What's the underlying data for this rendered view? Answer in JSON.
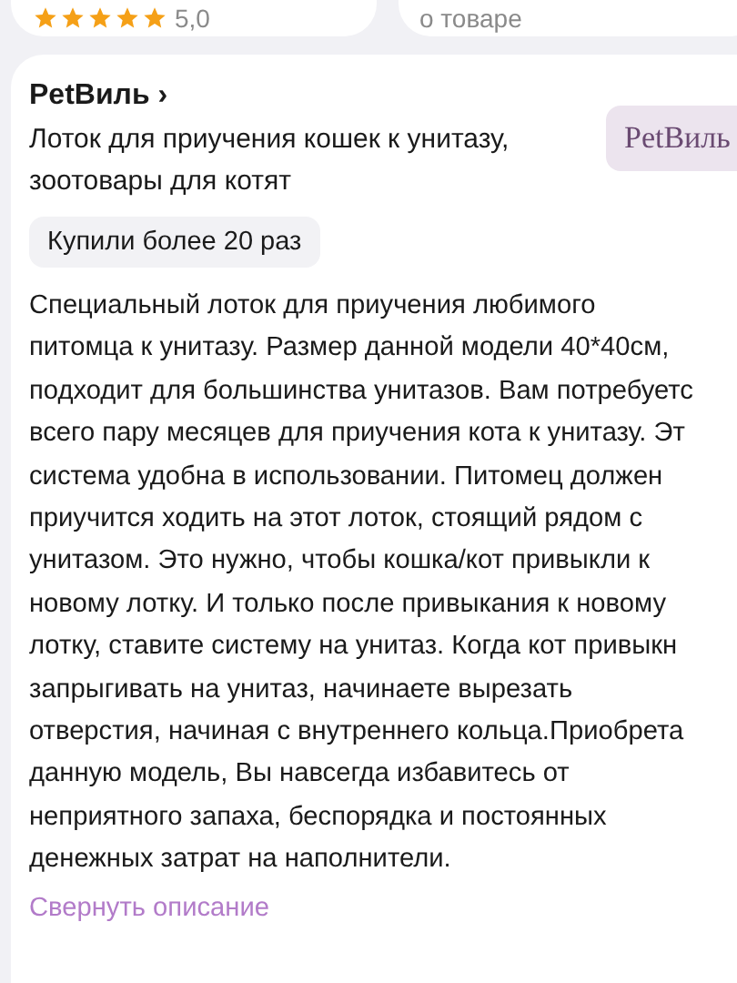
{
  "top_cards": [
    {
      "kind": "rating",
      "stars": 5,
      "rating": "5,0"
    },
    {
      "kind": "text",
      "text": "о товаре"
    }
  ],
  "seller": {
    "name": "PetВиль",
    "chevron": "›",
    "logo_text": "PetВиль"
  },
  "title": "Лоток для приучения кошек к унитазу, зоотовары для котят",
  "badge": "Купили более 20 раз",
  "description_lines": [
    "Специальный лоток для приучения любимого",
    "питомца к унитазу. Размер данной модели 40*40см,",
    "подходит для большинства унитазов. Вам потребуетс",
    "всего пару месяцев для приучения кота к унитазу. Эт",
    "система удобна в использовании. Питомец должен",
    "приучится ходить на этот лоток, стоящий рядом с",
    "унитазом. Это нужно, чтобы кошка/кот привыкли к",
    "новому лотку. И только после привыкания к новому",
    "лотку, ставите систему на унитаз. Когда кот привыкн",
    "запрыгивать на унитаз, начинаете вырезать",
    "отверстия, начиная с внутреннего кольца.Приобрета",
    "данную модель, Вы навсегда избавитесь от",
    "неприятного запаха, беспорядка и постоянных",
    "денежных затрат на наполнители."
  ],
  "collapse_link": "Свернуть описание"
}
